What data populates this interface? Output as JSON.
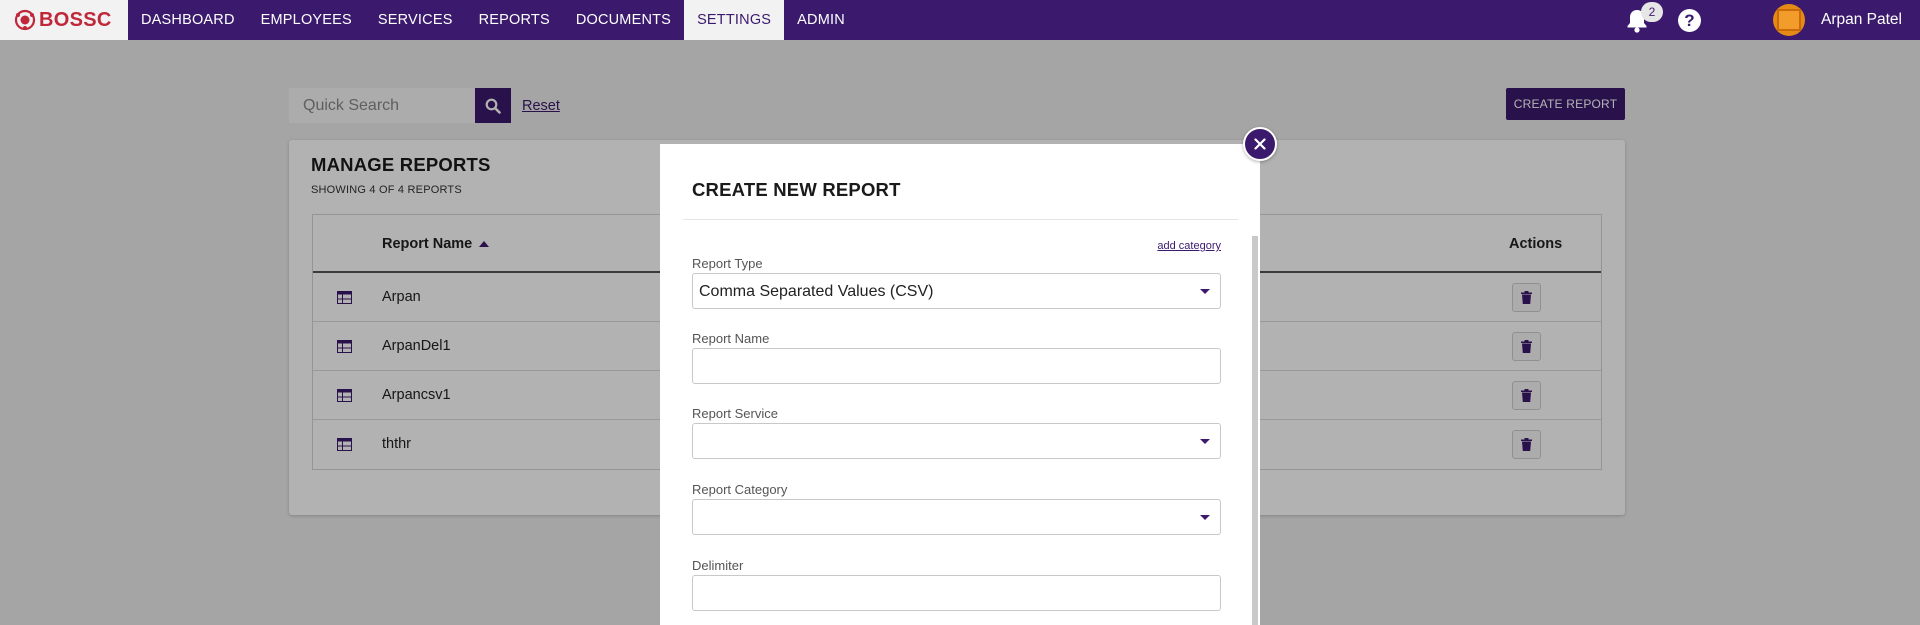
{
  "brand": {
    "name": "BOSSC",
    "color": "#c0283a"
  },
  "colors": {
    "primary": "#3b1a6d",
    "overlay": "rgba(0,0,0,0.30)"
  },
  "nav": {
    "items": [
      {
        "label": "DASHBOARD"
      },
      {
        "label": "EMPLOYEES"
      },
      {
        "label": "SERVICES"
      },
      {
        "label": "REPORTS"
      },
      {
        "label": "DOCUMENTS"
      },
      {
        "label": "SETTINGS",
        "active": true
      },
      {
        "label": "ADMIN"
      }
    ],
    "notification_count": "2",
    "help_icon": "question-circle-icon",
    "user_name": "Arpan Patel"
  },
  "toolbar": {
    "search_placeholder": "Quick Search",
    "reset_label": "Reset",
    "create_report_label": "CREATE REPORT"
  },
  "reports": {
    "title": "MANAGE REPORTS",
    "subtitle": "SHOWING 4 OF 4 REPORTS",
    "columns": {
      "name": "Report Name",
      "actions": "Actions"
    },
    "sort": "ascending",
    "rows": [
      {
        "name": "Arpan"
      },
      {
        "name": "ArpanDel1"
      },
      {
        "name": "Arpancsv1"
      },
      {
        "name": "ththr"
      }
    ]
  },
  "modal": {
    "title": "CREATE NEW REPORT",
    "add_category_label": "add category",
    "fields": {
      "report_type": {
        "label": "Report Type",
        "value": "Comma Separated Values (CSV)"
      },
      "report_name": {
        "label": "Report Name",
        "value": ""
      },
      "report_service": {
        "label": "Report Service",
        "value": ""
      },
      "report_category": {
        "label": "Report Category",
        "value": ""
      },
      "delimiter": {
        "label": "Delimiter",
        "value": ""
      }
    },
    "close_icon": "close-icon"
  }
}
